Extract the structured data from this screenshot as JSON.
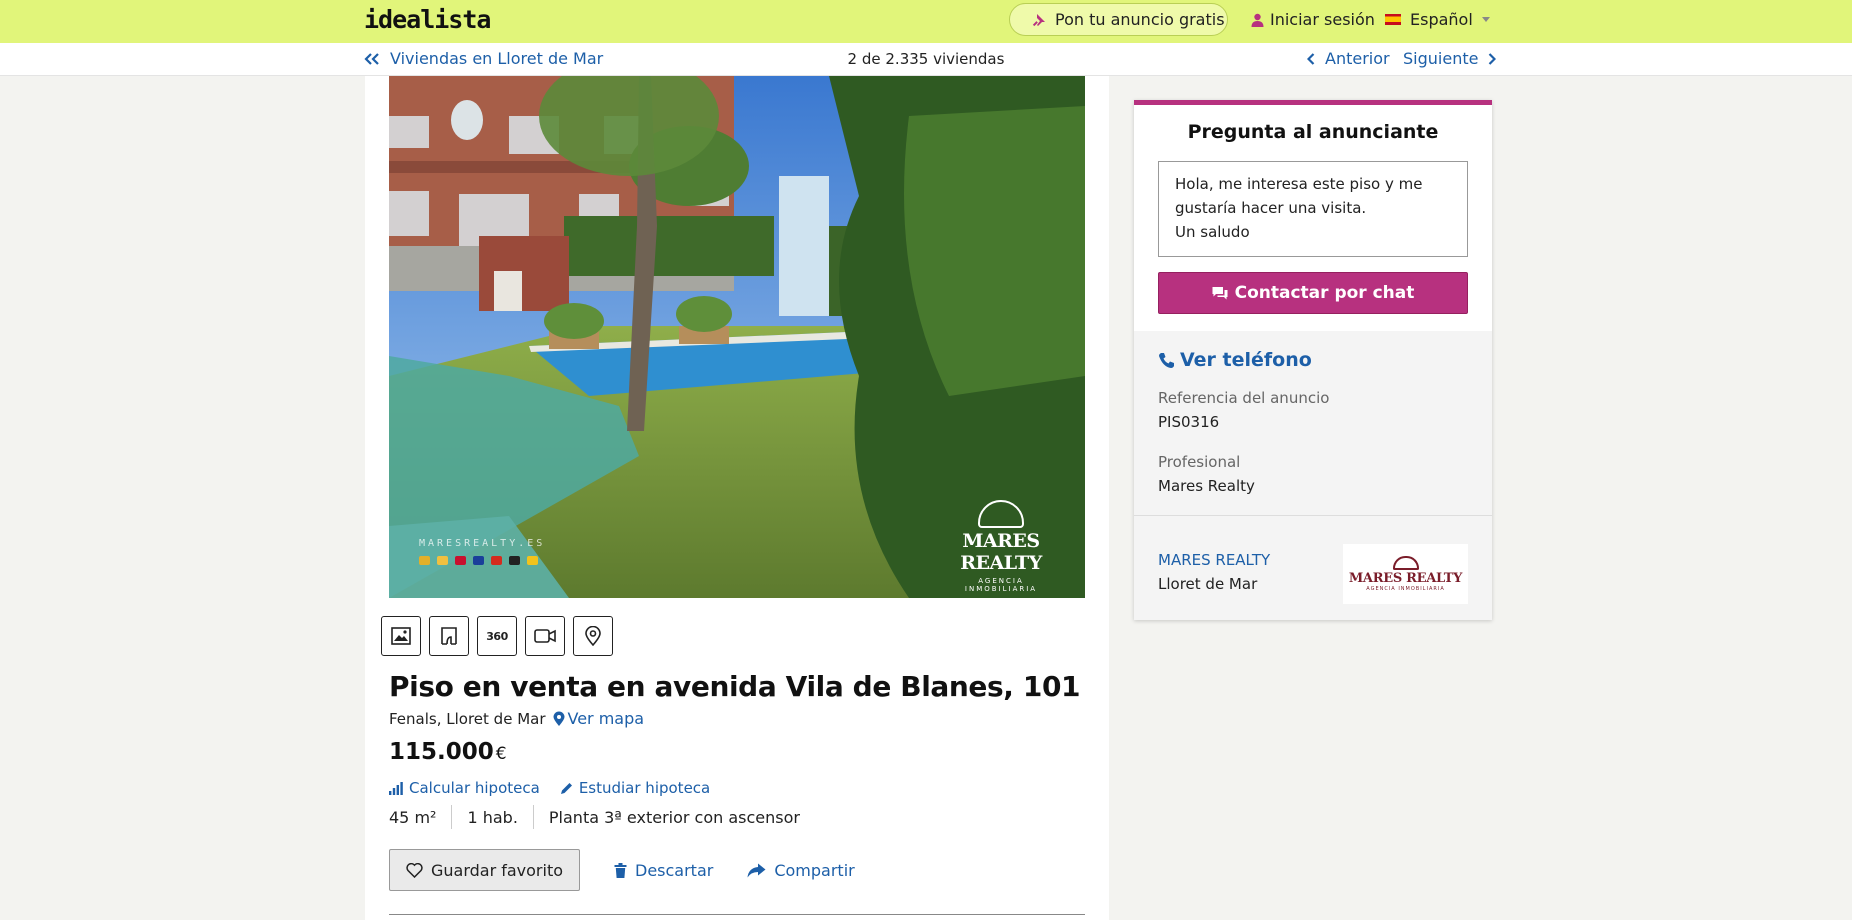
{
  "header": {
    "logo": "idealista",
    "post_ad_label": "Pon tu anuncio gratis",
    "login_label": "Iniciar sesión",
    "language_label": "Español"
  },
  "nav": {
    "back_label": "Viviendas en Lloret de Mar",
    "position_label": "2 de 2.335 viviendas",
    "prev_label": "Anterior",
    "next_label": "Siguiente"
  },
  "photo": {
    "watermark_site": "MARESREALTY.ES",
    "watermark_brand": "MARES REALTY",
    "watermark_sub": "AGENCIA INMOBILIARIA"
  },
  "media_buttons": [
    "photos-icon",
    "floorplan-icon",
    "360-icon",
    "video-icon",
    "map-pin-icon"
  ],
  "media_360_label": "360",
  "listing": {
    "title": "Piso en venta en avenida Vila de Blanes, 101",
    "location": "Fenals, Lloret de Mar",
    "map_label": "Ver mapa",
    "price": "115.000",
    "currency": "€",
    "calc_mortgage": "Calcular hipoteca",
    "study_mortgage": "Estudiar hipoteca",
    "features": [
      "45 m²",
      "1 hab.",
      "Planta 3ª exterior con ascensor"
    ],
    "favorite_label": "Guardar favorito",
    "discard_label": "Descartar",
    "share_label": "Compartir"
  },
  "contact": {
    "title": "Pregunta al anunciante",
    "message": "Hola, me interesa este piso y me\ngustaría hacer una visita.\nUn saludo",
    "chat_button": "Contactar por chat",
    "phone_label": "Ver teléfono",
    "ref_label": "Referencia del anuncio",
    "ref_value": "PIS0316",
    "pro_label": "Profesional",
    "pro_value": "Mares Realty",
    "agency_name": "MARES REALTY",
    "agency_city": "Lloret de Mar",
    "agency_logo_text": "MARES REALTY",
    "agency_logo_sub": "AGENCIA INMOBILIARIA"
  },
  "colors": {
    "header_bg": "#e1f57a",
    "link": "#1d5fa8",
    "accent": "#b7317f"
  }
}
